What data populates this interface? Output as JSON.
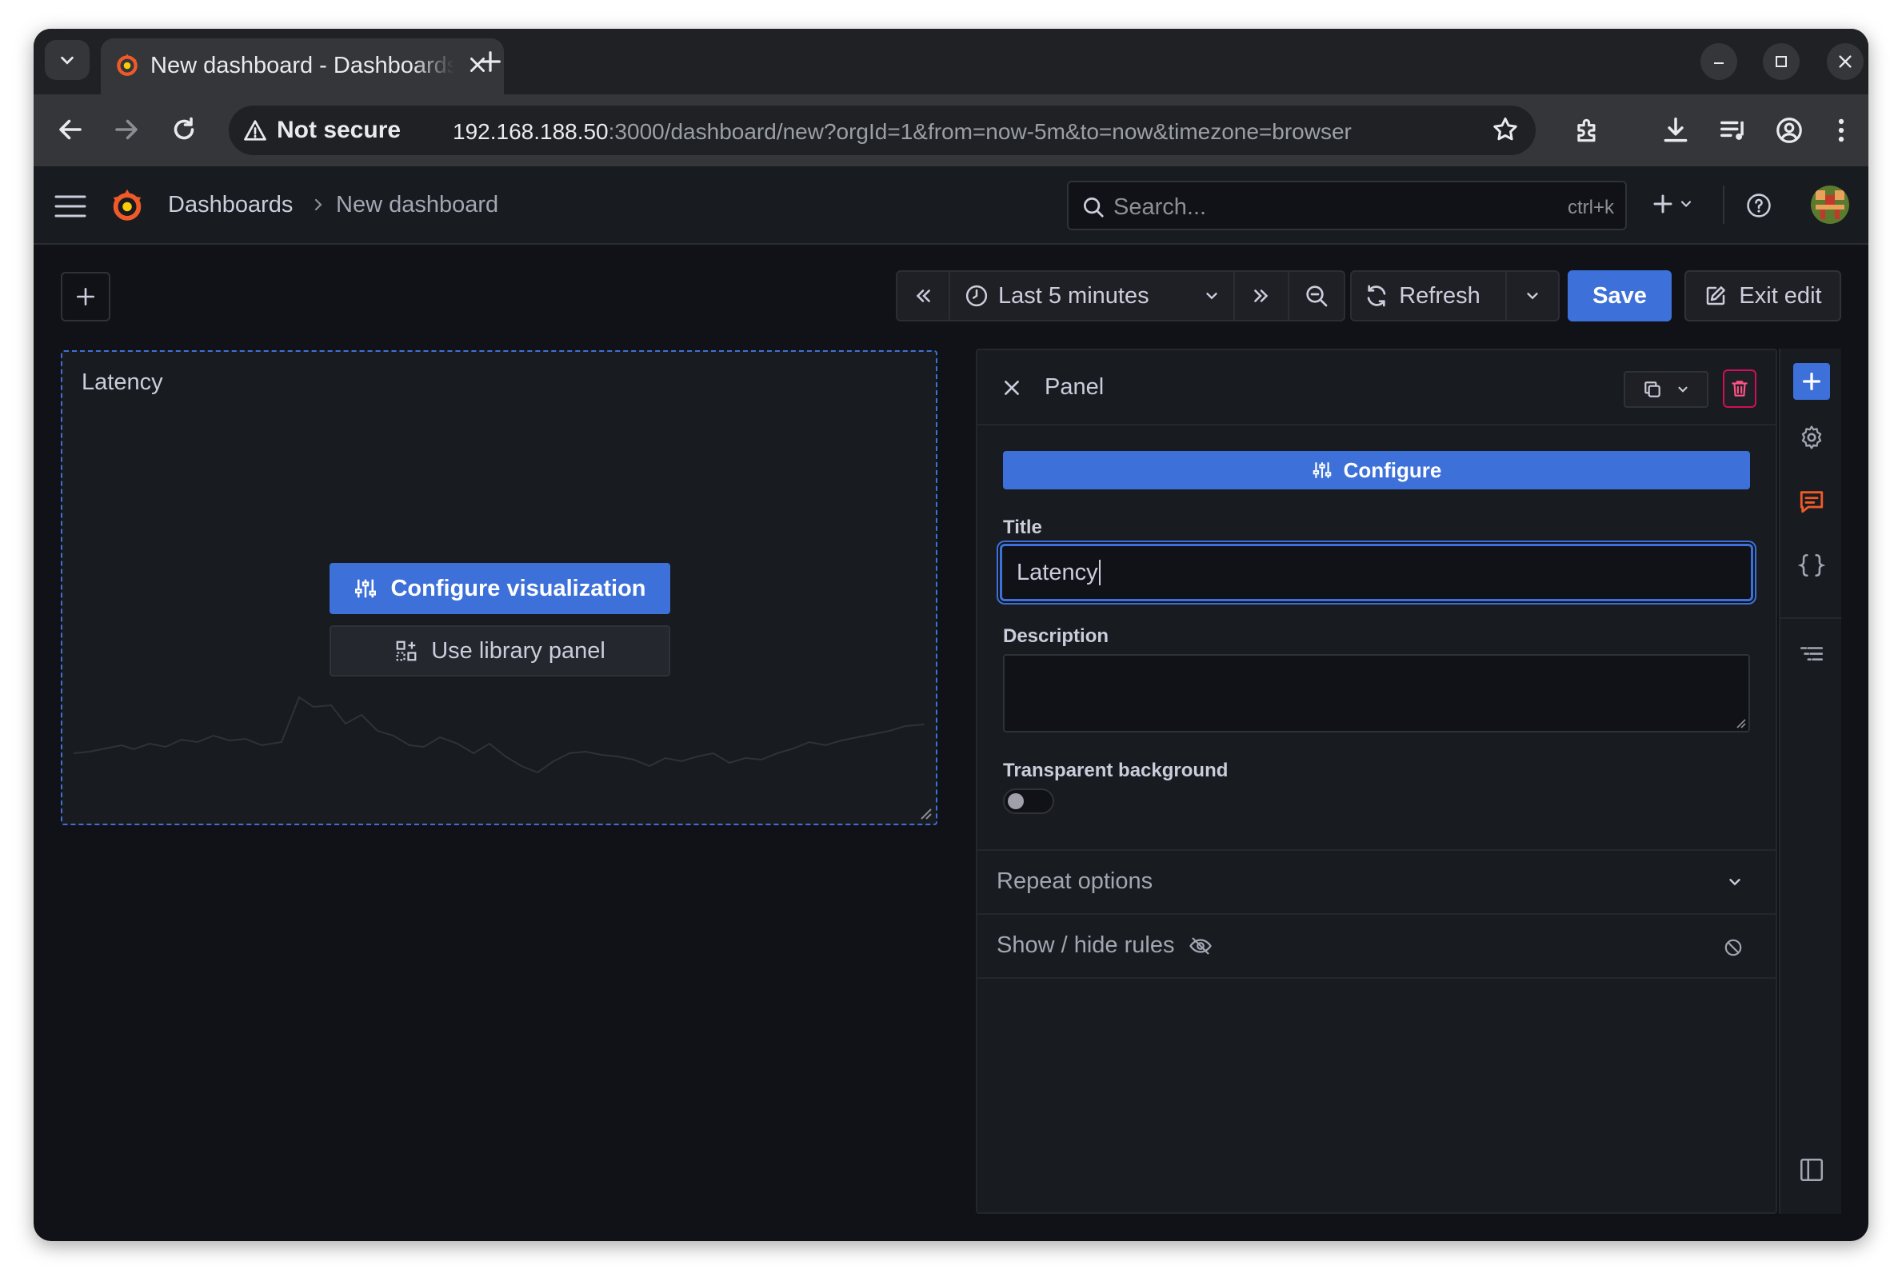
{
  "browser": {
    "tab_title": "New dashboard - Dashboards - Grafana",
    "security_label": "Not secure",
    "url_host": "192.168.188.50",
    "url_rest": ":3000/dashboard/new?orgId=1&from=now-5m&to=now&timezone=browser"
  },
  "topnav": {
    "breadcrumb_root": "Dashboards",
    "breadcrumb_current": "New dashboard",
    "search_placeholder": "Search...",
    "search_shortcut": "ctrl+k"
  },
  "toolbar": {
    "time_range": "Last 5 minutes",
    "refresh_label": "Refresh",
    "save_label": "Save",
    "exit_edit_label": "Exit edit"
  },
  "panel": {
    "title": "Latency",
    "configure_visualization_label": "Configure visualization",
    "library_panel_label": "Use library panel"
  },
  "editor": {
    "header_title": "Panel",
    "configure_label": "Configure",
    "title_label": "Title",
    "title_value": "Latency",
    "description_label": "Description",
    "description_value": "",
    "transparent_label": "Transparent background",
    "transparent_on": false,
    "repeat_options_label": "Repeat options",
    "show_hide_rules_label": "Show / hide rules"
  },
  "colors": {
    "accent": "#3d71d9",
    "danger": "#d10e5c",
    "grafana_orange": "#f05a28"
  },
  "icons": {
    "rail": [
      "plus-icon",
      "gear-icon",
      "comment-icon",
      "braces-icon",
      "list-icon",
      "sidebar-icon"
    ]
  }
}
